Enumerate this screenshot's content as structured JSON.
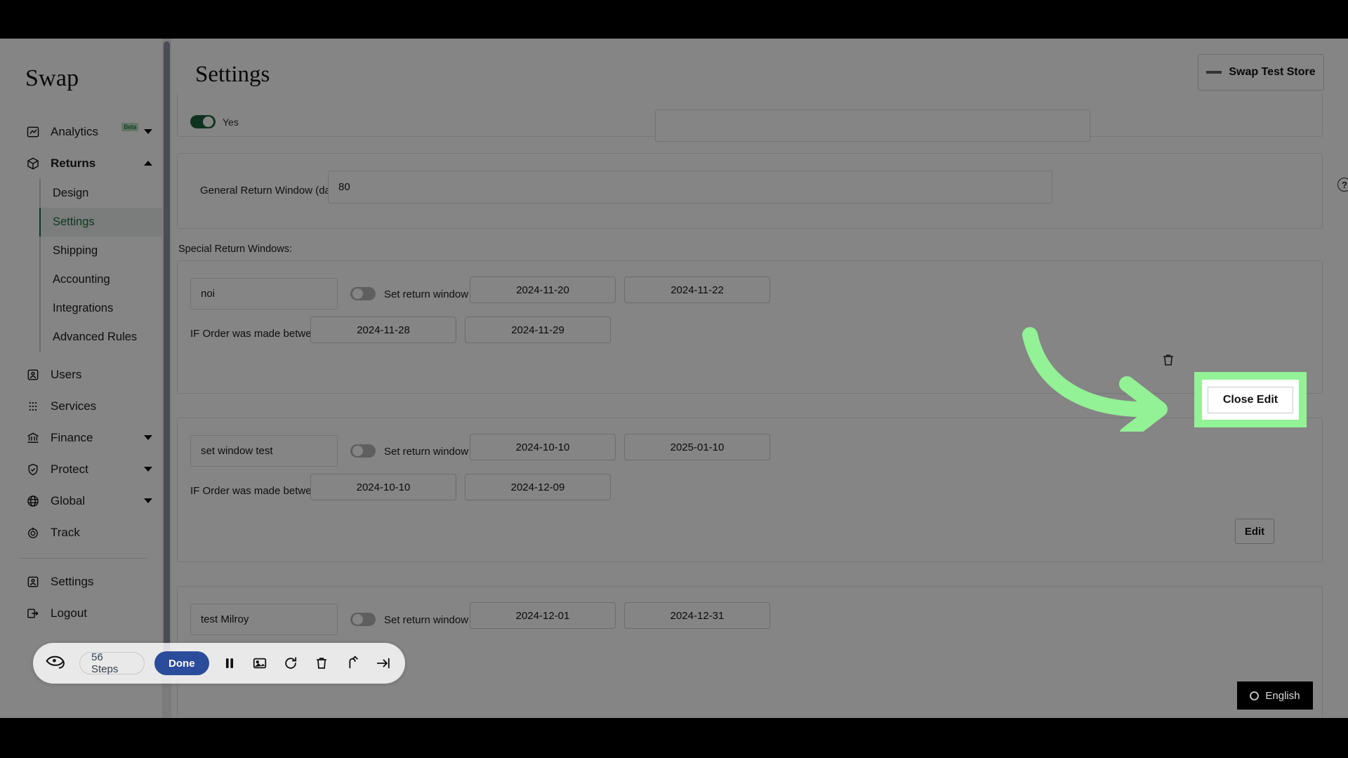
{
  "sidebar": {
    "brand": "Swap",
    "items": [
      {
        "label": "Analytics",
        "icon": "analytics-icon",
        "badge": "Beta",
        "caret": "down"
      },
      {
        "label": "Returns",
        "icon": "package-icon",
        "caret": "up",
        "bold": true
      }
    ],
    "returns_subitems": [
      {
        "label": "Design",
        "active": false
      },
      {
        "label": "Settings",
        "active": true
      },
      {
        "label": "Shipping",
        "active": false
      },
      {
        "label": "Accounting",
        "active": false
      },
      {
        "label": "Integrations",
        "active": false
      },
      {
        "label": "Advanced Rules",
        "active": false
      }
    ],
    "items_lower": [
      {
        "label": "Users",
        "icon": "user-card-icon",
        "caret": "none"
      },
      {
        "label": "Services",
        "icon": "grid-dots-icon",
        "caret": "none"
      },
      {
        "label": "Finance",
        "icon": "bank-icon",
        "caret": "down"
      },
      {
        "label": "Protect",
        "icon": "shield-check-icon",
        "caret": "down"
      },
      {
        "label": "Global",
        "icon": "globe-icon",
        "caret": "down"
      },
      {
        "label": "Track",
        "icon": "target-icon",
        "caret": "none"
      }
    ],
    "items_footer": [
      {
        "label": "Settings",
        "icon": "user-settings-icon"
      },
      {
        "label": "Logout",
        "icon": "logout-icon"
      }
    ]
  },
  "header": {
    "title": "Settings",
    "store_name": "Swap Test Store"
  },
  "top_panel": {
    "toggle_state": "on",
    "toggle_label": "Yes"
  },
  "general_return_window": {
    "label": "General Return Window (days)",
    "value": "80",
    "help_glyph": "?"
  },
  "special_return_windows": {
    "heading": "Special Return Windows:",
    "set_window_label": "Set return window to:",
    "if_order_label": "IF Order was made between",
    "cards": [
      {
        "name": "noi",
        "toggle_state": "off",
        "window_start": "2024-11-20",
        "window_end": "2024-11-22",
        "order_start": "2024-11-28",
        "order_end": "2024-11-29",
        "action_label": "Close Edit",
        "editing": true
      },
      {
        "name": "set window test",
        "toggle_state": "off",
        "window_start": "2024-10-10",
        "window_end": "2025-01-10",
        "order_start": "2024-10-10",
        "order_end": "2024-12-09",
        "action_label": "Edit",
        "editing": false
      },
      {
        "name": "test Milroy",
        "toggle_state": "off",
        "window_start": "2024-12-01",
        "window_end": "2024-12-31",
        "order_start": "",
        "order_end": "",
        "action_label": "",
        "editing": false
      }
    ]
  },
  "annotation": {
    "highlight_target": "Close Edit",
    "highlight_color": "#93f196",
    "arrow_color": "#93f196"
  },
  "agent_toolbar": {
    "steps_label": "56 Steps",
    "done_label": "Done",
    "buttons": [
      {
        "name": "pause-icon"
      },
      {
        "name": "image-icon"
      },
      {
        "name": "refresh-icon"
      },
      {
        "name": "trash-icon"
      },
      {
        "name": "upload-icon"
      },
      {
        "name": "skip-end-icon"
      }
    ]
  },
  "language_badge": {
    "label": "English",
    "icon": "circle-icon"
  }
}
